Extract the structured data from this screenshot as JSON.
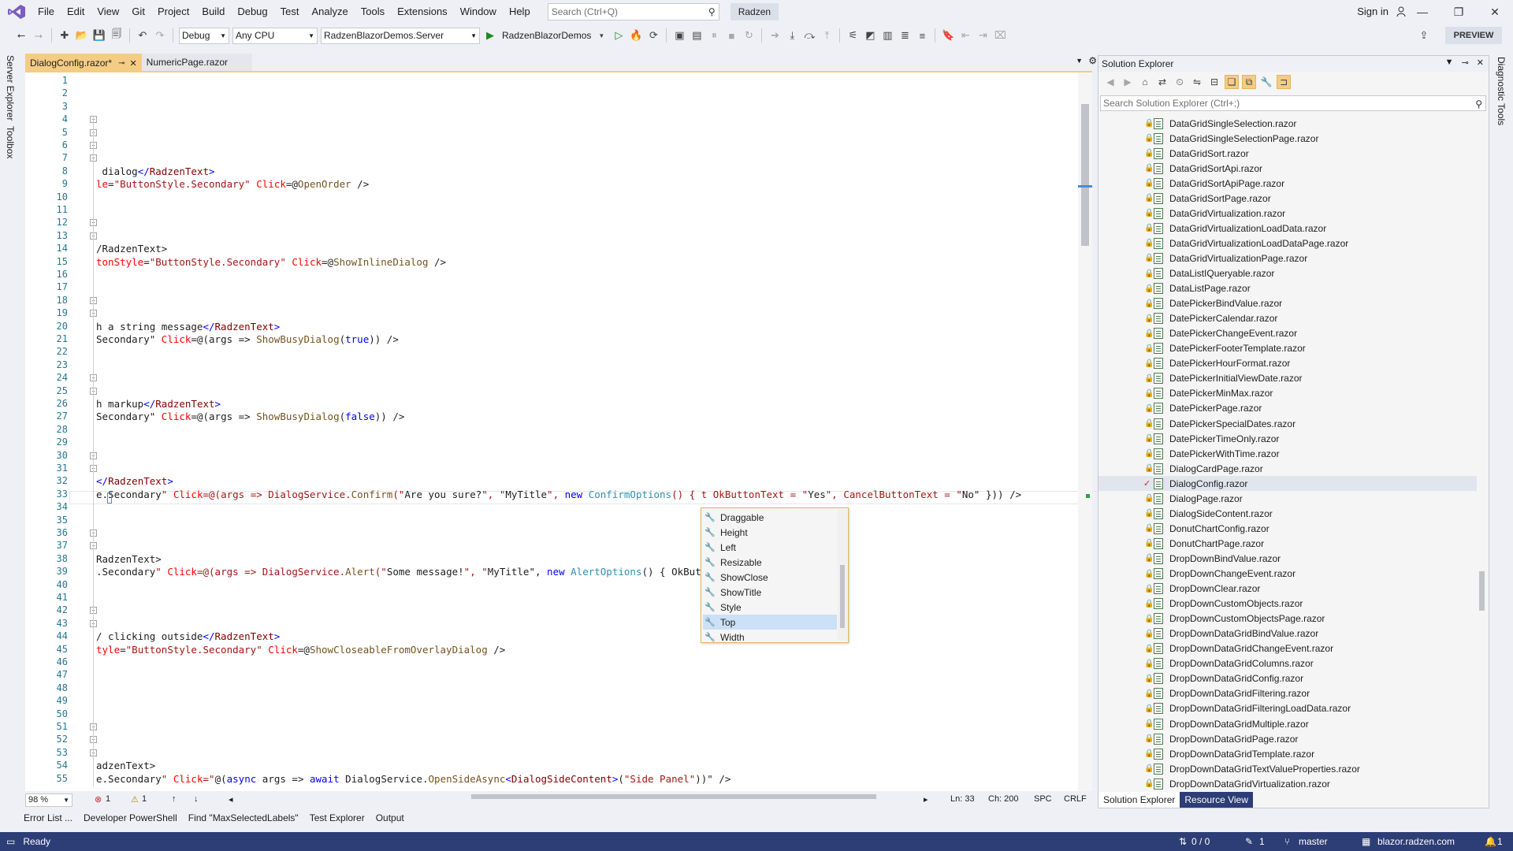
{
  "menu": [
    "File",
    "Edit",
    "View",
    "Git",
    "Project",
    "Build",
    "Debug",
    "Test",
    "Analyze",
    "Tools",
    "Extensions",
    "Window",
    "Help"
  ],
  "search": {
    "placeholder": "Search (Ctrl+Q)"
  },
  "solution_name": "Radzen",
  "signin": "Sign in",
  "toolbar": {
    "config": "Debug",
    "platform": "Any CPU",
    "startup": "RadzenBlazorDemos.Server",
    "run_label": "RadzenBlazorDemos",
    "preview": "PREVIEW"
  },
  "left_rail": [
    "Server Explorer",
    "Toolbox"
  ],
  "right_rail": [
    "Diagnostic Tools"
  ],
  "doc_tabs": [
    {
      "label": "DialogConfig.razor*",
      "active": true
    },
    {
      "label": "NumericPage.razor",
      "active": false
    }
  ],
  "code_lines": {
    "8": " dialog</RadzenText>",
    "9": "le=\"ButtonStyle.Secondary\" Click=@OpenOrder />",
    "14": "/RadzenText>",
    "15": "tonStyle=\"ButtonStyle.Secondary\" Click=@ShowInlineDialog />",
    "20": "h a string message</RadzenText>",
    "21": "Secondary\" Click=@(args => ShowBusyDialog(true)) />",
    "26": "h markup</RadzenText>",
    "27": "Secondary\" Click=@(args => ShowBusyDialog(false)) />",
    "32": "</RadzenText>",
    "33": "e.Secondary\" Click=@(args => DialogService.Confirm(\"Are you sure?\", \"MyTitle\", new ConfirmOptions() { t OkButtonText = \"Yes\", CancelButtonText = \"No\" })) />",
    "38": "RadzenText>",
    "39": ".Secondary\" Click=@(args => DialogService.Alert(\"Some message!\", \"MyTitle\", new AlertOptions() { OkButt",
    "44": "/ clicking outside</RadzenText>",
    "45": "tyle=\"ButtonStyle.Secondary\" Click=@ShowCloseableFromOverlayDialog />",
    "54": "adzenText>",
    "55": "e.Secondary\" Click=\"@(async args => await DialogService.OpenSideAsync<DialogSideContent>(\"Side Panel\"))\" />"
  },
  "line_count": 55,
  "intellisense": {
    "items": [
      "Draggable",
      "Height",
      "Left",
      "Resizable",
      "ShowClose",
      "ShowTitle",
      "Style",
      "Top",
      "Width"
    ],
    "selected": "Top"
  },
  "editor_status": {
    "zoom": "98 %",
    "errors": "1",
    "warnings": "1",
    "ln": "Ln: 33",
    "ch": "Ch: 200",
    "spc": "SPC",
    "crlf": "CRLF"
  },
  "tool_tabs": [
    "Error List ...",
    "Developer PowerShell",
    "Find \"MaxSelectedLabels\"",
    "Test Explorer",
    "Output"
  ],
  "status_bar": {
    "ready": "Ready",
    "sync": "0 / 0",
    "edits": "1",
    "branch": "master",
    "repo": "blazor.radzen.com",
    "notif": "1"
  },
  "solution_explorer": {
    "title": "Solution Explorer",
    "search_placeholder": "Search Solution Explorer (Ctrl+;)",
    "files": [
      "DataGridSingleSelection.razor",
      "DataGridSingleSelectionPage.razor",
      "DataGridSort.razor",
      "DataGridSortApi.razor",
      "DataGridSortApiPage.razor",
      "DataGridSortPage.razor",
      "DataGridVirtualization.razor",
      "DataGridVirtualizationLoadData.razor",
      "DataGridVirtualizationLoadDataPage.razor",
      "DataGridVirtualizationPage.razor",
      "DataListIQueryable.razor",
      "DataListPage.razor",
      "DatePickerBindValue.razor",
      "DatePickerCalendar.razor",
      "DatePickerChangeEvent.razor",
      "DatePickerFooterTemplate.razor",
      "DatePickerHourFormat.razor",
      "DatePickerInitialViewDate.razor",
      "DatePickerMinMax.razor",
      "DatePickerPage.razor",
      "DatePickerSpecialDates.razor",
      "DatePickerTimeOnly.razor",
      "DatePickerWithTime.razor",
      "DialogCardPage.razor",
      "DialogConfig.razor",
      "DialogPage.razor",
      "DialogSideContent.razor",
      "DonutChartConfig.razor",
      "DonutChartPage.razor",
      "DropDownBindValue.razor",
      "DropDownChangeEvent.razor",
      "DropDownClear.razor",
      "DropDownCustomObjects.razor",
      "DropDownCustomObjectsPage.razor",
      "DropDownDataGridBindValue.razor",
      "DropDownDataGridChangeEvent.razor",
      "DropDownDataGridColumns.razor",
      "DropDownDataGridConfig.razor",
      "DropDownDataGridFiltering.razor",
      "DropDownDataGridFilteringLoadData.razor",
      "DropDownDataGridMultiple.razor",
      "DropDownDataGridPage.razor",
      "DropDownDataGridTemplate.razor",
      "DropDownDataGridTextValueProperties.razor",
      "DropDownDataGridVirtualization.razor"
    ],
    "selected": "DialogConfig.razor",
    "tabs": [
      "Solution Explorer",
      "Resource View"
    ]
  }
}
